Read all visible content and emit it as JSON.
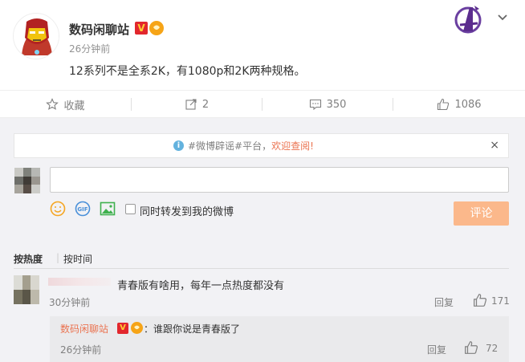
{
  "post": {
    "author": "数码闲聊站",
    "time": "26分钟前",
    "text": "12系列不是全系2K，有1080p和2K两种规格。",
    "badge_v": "V"
  },
  "actions": {
    "favorite_label": "收藏",
    "repost_count": "2",
    "comment_count": "350",
    "like_count": "1086"
  },
  "notice": {
    "prefix": "#微博辟谣#平台，",
    "link": "欢迎查阅!",
    "close": "×"
  },
  "composer": {
    "placeholder": "",
    "repost_label": "同时转发到我的微博",
    "submit_label": "评论"
  },
  "sort": {
    "hot_label": "按热度",
    "time_label": "按时间"
  },
  "comments": [
    {
      "text": "青春版有啥用，每年一点热度都没有",
      "time": "30分钟前",
      "reply_label": "回复",
      "likes": "171",
      "replies": [
        {
          "user": "数码闲聊站",
          "badge_v": "V",
          "text": "：谁跟你说是青春版了",
          "time": "26分钟前",
          "reply_label": "回复",
          "likes": "72"
        }
      ]
    }
  ],
  "colors": {
    "accent": "#eb7350",
    "submit_disabled": "#fbb88b",
    "page_bg": "#f2f2f5"
  }
}
